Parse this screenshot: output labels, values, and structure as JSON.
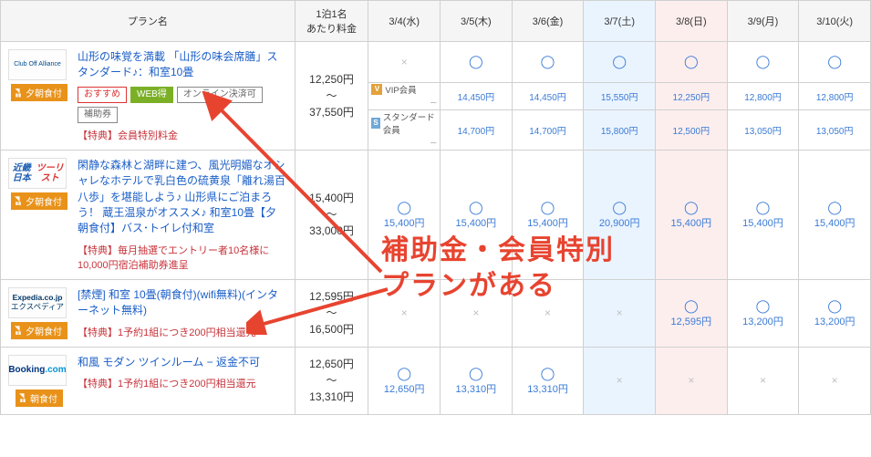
{
  "headers": {
    "plan": "プラン名",
    "price": "1泊1名\nあたり料金",
    "dates": [
      "3/4(水)",
      "3/5(木)",
      "3/6(金)",
      "3/7(土)",
      "3/8(日)",
      "3/9(月)",
      "3/10(火)"
    ]
  },
  "overlay_text": "補助金・会員特別\nプランがある",
  "plans": [
    {
      "brand": "Club Off Alliance",
      "brand_style": "cluboff",
      "meal": "夕朝食付",
      "title": "山形の味覚を満載 「山形の味会席膳」スタンダード♪：和室10畳",
      "tags": [
        {
          "label": "おすすめ",
          "cls": "tag-osusume"
        },
        {
          "label": "WEB得",
          "cls": "tag-web"
        },
        {
          "label": "オンライン決済可",
          "cls": "tag-online"
        },
        {
          "label": "補助券",
          "cls": "tag-hojo"
        }
      ],
      "bonus": "【特典】会員特別料金",
      "price_low": "12,250円",
      "price_high": "37,550円",
      "dates": [
        {
          "avail": "x"
        },
        {
          "avail": "o"
        },
        {
          "avail": "o"
        },
        {
          "avail": "o",
          "cls": "sat"
        },
        {
          "avail": "o",
          "cls": "sun"
        },
        {
          "avail": "o"
        },
        {
          "avail": "o"
        }
      ],
      "member_rows": [
        {
          "icon": "V",
          "icon_cls": "mem-v",
          "label": "VIP会員",
          "prices": [
            "−",
            "14,450円",
            "14,450円",
            "15,550円",
            "12,250円",
            "12,800円",
            "12,800円"
          ]
        },
        {
          "icon": "S",
          "icon_cls": "mem-s",
          "label": "スタンダード会員",
          "prices": [
            "−",
            "14,700円",
            "14,700円",
            "15,800円",
            "12,500円",
            "13,050円",
            "13,050円"
          ]
        }
      ]
    },
    {
      "brand_html": "<span class='knt-blue'>近畿日本</span><br><span class='knt-red'>ツーリスト</span>",
      "meal": "夕朝食付",
      "title": "閑静な森林と湖畔に建つ、風光明媚なオシャレなホテルで乳白色の硫黄泉「離れ湯百八歩」を堪能しよう♪ 山形県にご泊まろう！ 蔵王温泉がオススメ♪ 和室10畳【夕朝食付】バス･トイレ付和室",
      "bonus": "【特典】毎月抽選でエントリー者10名様に10,000円宿泊補助券進呈",
      "price_low": "15,400円",
      "price_high": "33,000円",
      "dates": [
        {
          "avail": "o",
          "price": "15,400円"
        },
        {
          "avail": "o",
          "price": "15,400円"
        },
        {
          "avail": "o",
          "price": "15,400円"
        },
        {
          "avail": "o",
          "price": "20,900円",
          "cls": "sat"
        },
        {
          "avail": "o",
          "price": "15,400円",
          "cls": "sun"
        },
        {
          "avail": "o",
          "price": "15,400円"
        },
        {
          "avail": "o",
          "price": "15,400円"
        }
      ]
    },
    {
      "brand_html": "<span class='expedia'><b>Expedia.co.jp</b><br>エクスペディア</span>",
      "meal": "夕朝食付",
      "title": "[禁煙] 和室 10畳(朝食付)(wifi無料)(インターネット無料)",
      "bonus": "【特典】1予約1組につき200円相当還元",
      "price_low": "12,595円",
      "price_high": "16,500円",
      "dates": [
        {
          "avail": "x"
        },
        {
          "avail": "x"
        },
        {
          "avail": "x"
        },
        {
          "avail": "x",
          "cls": "sat"
        },
        {
          "avail": "o",
          "price": "12,595円",
          "cls": "sun"
        },
        {
          "avail": "o",
          "price": "13,200円"
        },
        {
          "avail": "o",
          "price": "13,200円"
        }
      ]
    },
    {
      "brand_html": "<span class='booking-b'>Booking</span><span class='booking-c'>.com</span>",
      "meal": "朝食付",
      "title": "和風 モダン ツインルーム − 返金不可",
      "bonus": "【特典】1予約1組につき200円相当還元",
      "price_low": "12,650円",
      "price_high": "13,310円",
      "dates": [
        {
          "avail": "o",
          "price": "12,650円"
        },
        {
          "avail": "o",
          "price": "13,310円"
        },
        {
          "avail": "o",
          "price": "13,310円"
        },
        {
          "avail": "x",
          "cls": "sat"
        },
        {
          "avail": "x",
          "cls": "sun"
        },
        {
          "avail": "x"
        },
        {
          "avail": "x"
        }
      ]
    }
  ]
}
